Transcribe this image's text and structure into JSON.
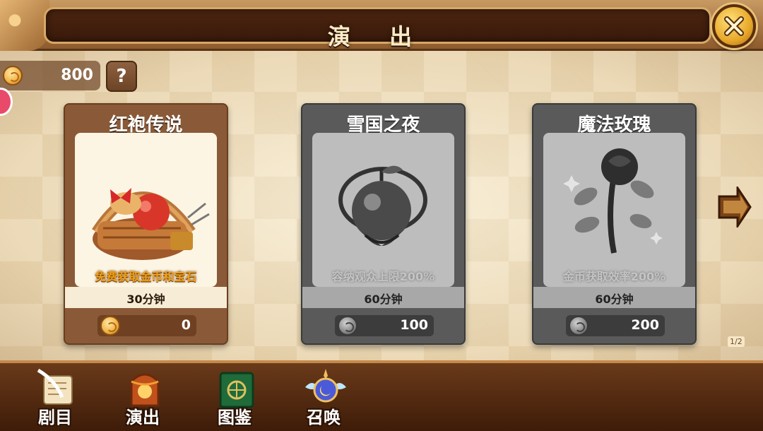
{
  "header": {
    "title": "演 出"
  },
  "currency": {
    "value": "800",
    "help_label": "?"
  },
  "cards": [
    {
      "title": "红袍传说",
      "description": "免费获取金币和宝石",
      "duration": "30分钟",
      "cost": "0",
      "state": "unlocked"
    },
    {
      "title": "雪国之夜",
      "description": "容纳观众上限200%",
      "duration": "60分钟",
      "cost": "100",
      "state": "locked"
    },
    {
      "title": "魔法玫瑰",
      "description": "金币获取效率200%",
      "duration": "60分钟",
      "cost": "200",
      "state": "locked"
    }
  ],
  "pagination": {
    "label": "1/2"
  },
  "bottom_nav": [
    {
      "label": "剧目",
      "icon": "scroll-quill-icon"
    },
    {
      "label": "演出",
      "icon": "stage-lantern-icon"
    },
    {
      "label": "图鉴",
      "icon": "book-icon"
    },
    {
      "label": "召唤",
      "icon": "winged-orb-icon"
    }
  ],
  "colors": {
    "accent_gold": "#e7a82a",
    "wood_dark": "#3e1c08",
    "desc_orange": "#f2a21a"
  }
}
